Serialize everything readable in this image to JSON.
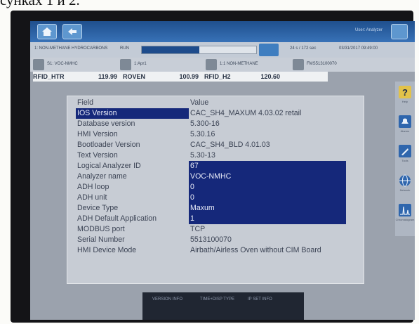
{
  "caption": "сунках 1 и 2.",
  "topbar": {
    "user": "User: Analyzer",
    "home_icon": "home-icon",
    "back_icon": "back-icon",
    "help_icon": "help-icon"
  },
  "status": {
    "left_text": "1: NON-METHANE HYDROCARBONS",
    "mode": "RUN",
    "progress": 0.5,
    "right_info": "24 s / 172 sec",
    "datetime": "03/31/2017 09:49:00"
  },
  "streams": {
    "s1": "S1: VOC-NMHC",
    "s2": "1:Apr1",
    "s3": "1:1 NON-METHANE",
    "s4": "FMS513100070"
  },
  "measurements": [
    {
      "name": "RFID_HTR",
      "value": "119.99"
    },
    {
      "name": "ROVEN",
      "value": "100.99"
    },
    {
      "name": "RFID_H2",
      "value": "120.60"
    }
  ],
  "table": {
    "header_field": "Field",
    "header_value": "Value",
    "rows": [
      {
        "field": "IOS Version",
        "value": "CAC_SH4_MAXUM 4.03.02 retail"
      },
      {
        "field": "Database version",
        "value": "5.300-16"
      },
      {
        "field": "HMI Version",
        "value": "5.30.16"
      },
      {
        "field": "Bootloader Version",
        "value": "CAC_SH4_BLD 4.01.03"
      },
      {
        "field": "Text Version",
        "value": "5.30-13"
      },
      {
        "field": "Logical Analyzer ID",
        "value": "67"
      },
      {
        "field": "Analyzer name",
        "value": "VOC-NMHC"
      },
      {
        "field": "ADH loop",
        "value": "0"
      },
      {
        "field": "ADH unit",
        "value": "0"
      },
      {
        "field": "Device Type",
        "value": "Maxum"
      },
      {
        "field": "ADH Default Application",
        "value": "1"
      },
      {
        "field": "MODBUS port",
        "value": "TCP"
      },
      {
        "field": "Serial Number",
        "value": "5513100070"
      },
      {
        "field": "HMI Device Mode",
        "value": "Airbath/Airless Oven without CIM Board"
      }
    ]
  },
  "sidebar": {
    "items": [
      {
        "label": "Help",
        "icon": "help-icon"
      },
      {
        "label": "Alarms",
        "icon": "alarm-icon"
      },
      {
        "label": "Tools",
        "icon": "wrench-icon"
      },
      {
        "label": "Network",
        "icon": "globe-icon"
      },
      {
        "label": "Chromatogram",
        "icon": "chromatogram-icon"
      }
    ]
  },
  "bottom": {
    "btn1": "VERSION INFO",
    "btn2": "TIME+DISP TYPE",
    "btn3": "IP SET INFO"
  },
  "colors": {
    "selection": "#15287a",
    "topbar": "#2d62a3"
  }
}
